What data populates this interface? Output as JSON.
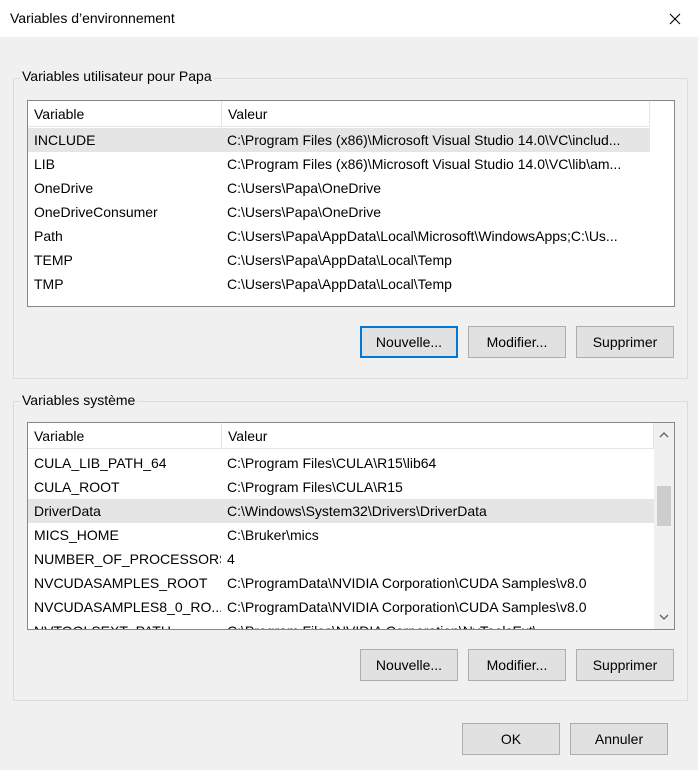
{
  "window": {
    "title": "Variables d’environnement"
  },
  "user_group": {
    "label": "Variables utilisateur pour Papa",
    "columns": [
      "Variable",
      "Valeur"
    ],
    "rows": [
      {
        "name": "INCLUDE",
        "value": "C:\\Program Files (x86)\\Microsoft Visual Studio 14.0\\VC\\includ...",
        "selected": true
      },
      {
        "name": "LIB",
        "value": "C:\\Program Files (x86)\\Microsoft Visual Studio 14.0\\VC\\lib\\am..."
      },
      {
        "name": "OneDrive",
        "value": "C:\\Users\\Papa\\OneDrive"
      },
      {
        "name": "OneDriveConsumer",
        "value": "C:\\Users\\Papa\\OneDrive"
      },
      {
        "name": "Path",
        "value": "C:\\Users\\Papa\\AppData\\Local\\Microsoft\\WindowsApps;C:\\Us..."
      },
      {
        "name": "TEMP",
        "value": "C:\\Users\\Papa\\AppData\\Local\\Temp"
      },
      {
        "name": "TMP",
        "value": "C:\\Users\\Papa\\AppData\\Local\\Temp"
      }
    ],
    "buttons": {
      "new": "Nouvelle...",
      "edit": "Modifier...",
      "delete": "Supprimer"
    }
  },
  "system_group": {
    "label": "Variables système",
    "columns": [
      "Variable",
      "Valeur"
    ],
    "rows": [
      {
        "name": "CULA_LIB_PATH_64",
        "value": "C:\\Program Files\\CULA\\R15\\lib64"
      },
      {
        "name": "CULA_ROOT",
        "value": "C:\\Program Files\\CULA\\R15"
      },
      {
        "name": "DriverData",
        "value": "C:\\Windows\\System32\\Drivers\\DriverData",
        "selected": true
      },
      {
        "name": "MICS_HOME",
        "value": "C:\\Bruker\\mics"
      },
      {
        "name": "NUMBER_OF_PROCESSORS",
        "value": "4"
      },
      {
        "name": "NVCUDASAMPLES_ROOT",
        "value": "C:\\ProgramData\\NVIDIA Corporation\\CUDA Samples\\v8.0"
      },
      {
        "name": "NVCUDASAMPLES8_0_RO...",
        "value": "C:\\ProgramData\\NVIDIA Corporation\\CUDA Samples\\v8.0"
      },
      {
        "name": "NVTOOLSEXT_PATH",
        "value": "C:\\Program Files\\NVIDIA Corporation\\NvToolsExt\\"
      }
    ],
    "buttons": {
      "new": "Nouvelle...",
      "edit": "Modifier...",
      "delete": "Supprimer"
    }
  },
  "footer": {
    "ok": "OK",
    "cancel": "Annuler"
  }
}
